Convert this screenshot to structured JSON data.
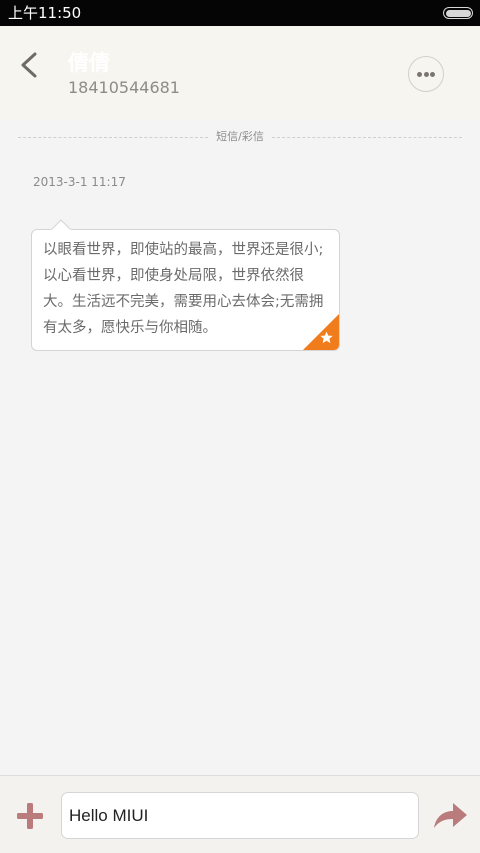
{
  "status_bar": {
    "time": "上午11:50"
  },
  "header": {
    "contact_name": "倩倩",
    "phone_number": "18410544681",
    "back_icon": "chevron-left-icon",
    "more_icon": "more-dots-icon"
  },
  "conversation": {
    "section_label": "短信/彩信",
    "timestamp": "2013-3-1 11:17",
    "messages": [
      {
        "text": "以眼看世界，即使站的最高，世界还是很小;以心看世界，即使身处局限，世界依然很大。生活远不完美，需要用心去体会;无需拥有太多，愿快乐与你相随。",
        "favorited": true
      }
    ]
  },
  "compose": {
    "input_value": "Hello MIUI",
    "add_icon": "plus-icon",
    "send_icon": "send-arrow-icon"
  },
  "colors": {
    "accent_orange": "#f07c1c",
    "icon_brown": "#b97b7b",
    "status_bar_bg": "#050505",
    "header_bg": "#f7f5ef",
    "page_bg": "#f4f4f4"
  }
}
